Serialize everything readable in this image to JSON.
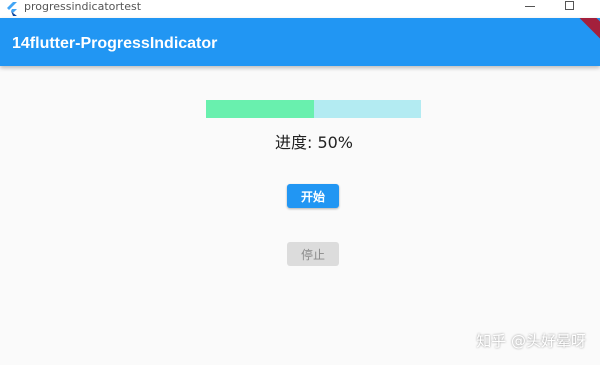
{
  "window": {
    "title": "progressindicatortest"
  },
  "appbar": {
    "title": "14flutter-ProgressIndicator"
  },
  "progress": {
    "value": 0.5,
    "label": "进度: 50%",
    "track_color": "#b3ebf2",
    "fill_color": "#69f0ae"
  },
  "buttons": {
    "start_label": "开始",
    "stop_label": "停止"
  },
  "watermark": {
    "text": "知乎 @头好晕呀"
  },
  "colors": {
    "primary": "#2196f3",
    "background": "#fafafa"
  }
}
